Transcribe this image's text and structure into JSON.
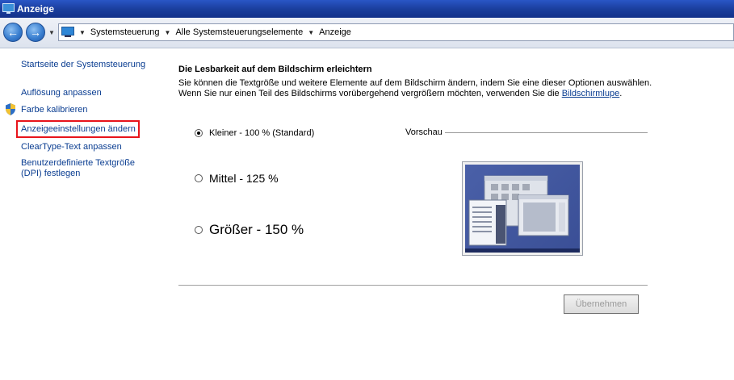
{
  "window": {
    "title": "Anzeige"
  },
  "addressbar": {
    "breadcrumbs": [
      "Systemsteuerung",
      "Alle Systemsteuerungselemente",
      "Anzeige"
    ]
  },
  "sidebar": {
    "items": [
      {
        "label": "Startseite der Systemsteuerung"
      },
      {
        "label": "Auflösung anpassen"
      },
      {
        "label": "Farbe kalibrieren",
        "icon": "shield-icon"
      },
      {
        "label": "Anzeigeeinstellungen ändern",
        "highlighted": true
      },
      {
        "label": "ClearType-Text anpassen"
      },
      {
        "label_line1": "Benutzerdefinierte Textgröße",
        "label_line2": "(DPI) festlegen"
      }
    ]
  },
  "main": {
    "heading": "Die Lesbarkeit auf dem Bildschirm erleichtern",
    "desc_line1": "Sie können die Textgröße und weitere Elemente auf dem Bildschirm ändern, indem Sie eine dieser Optionen auswählen.",
    "desc_line2_prefix": "Wenn Sie nur einen Teil des Bildschirms vorübergehend vergrößern möchten, verwenden Sie die",
    "desc_line2_link": "Bildschirmlupe",
    "desc_line2_suffix": ".",
    "options": [
      {
        "label": "Kleiner - 100 % (Standard)",
        "checked": true
      },
      {
        "label": "Mittel - 125 %",
        "checked": false
      },
      {
        "label": "Größer - 150 %",
        "checked": false
      }
    ],
    "preview_label": "Vorschau",
    "apply_label": "Übernehmen"
  },
  "colors": {
    "link": "#0a3d91",
    "highlight": "#e8141b",
    "titlebar": "#1b3f9e"
  }
}
